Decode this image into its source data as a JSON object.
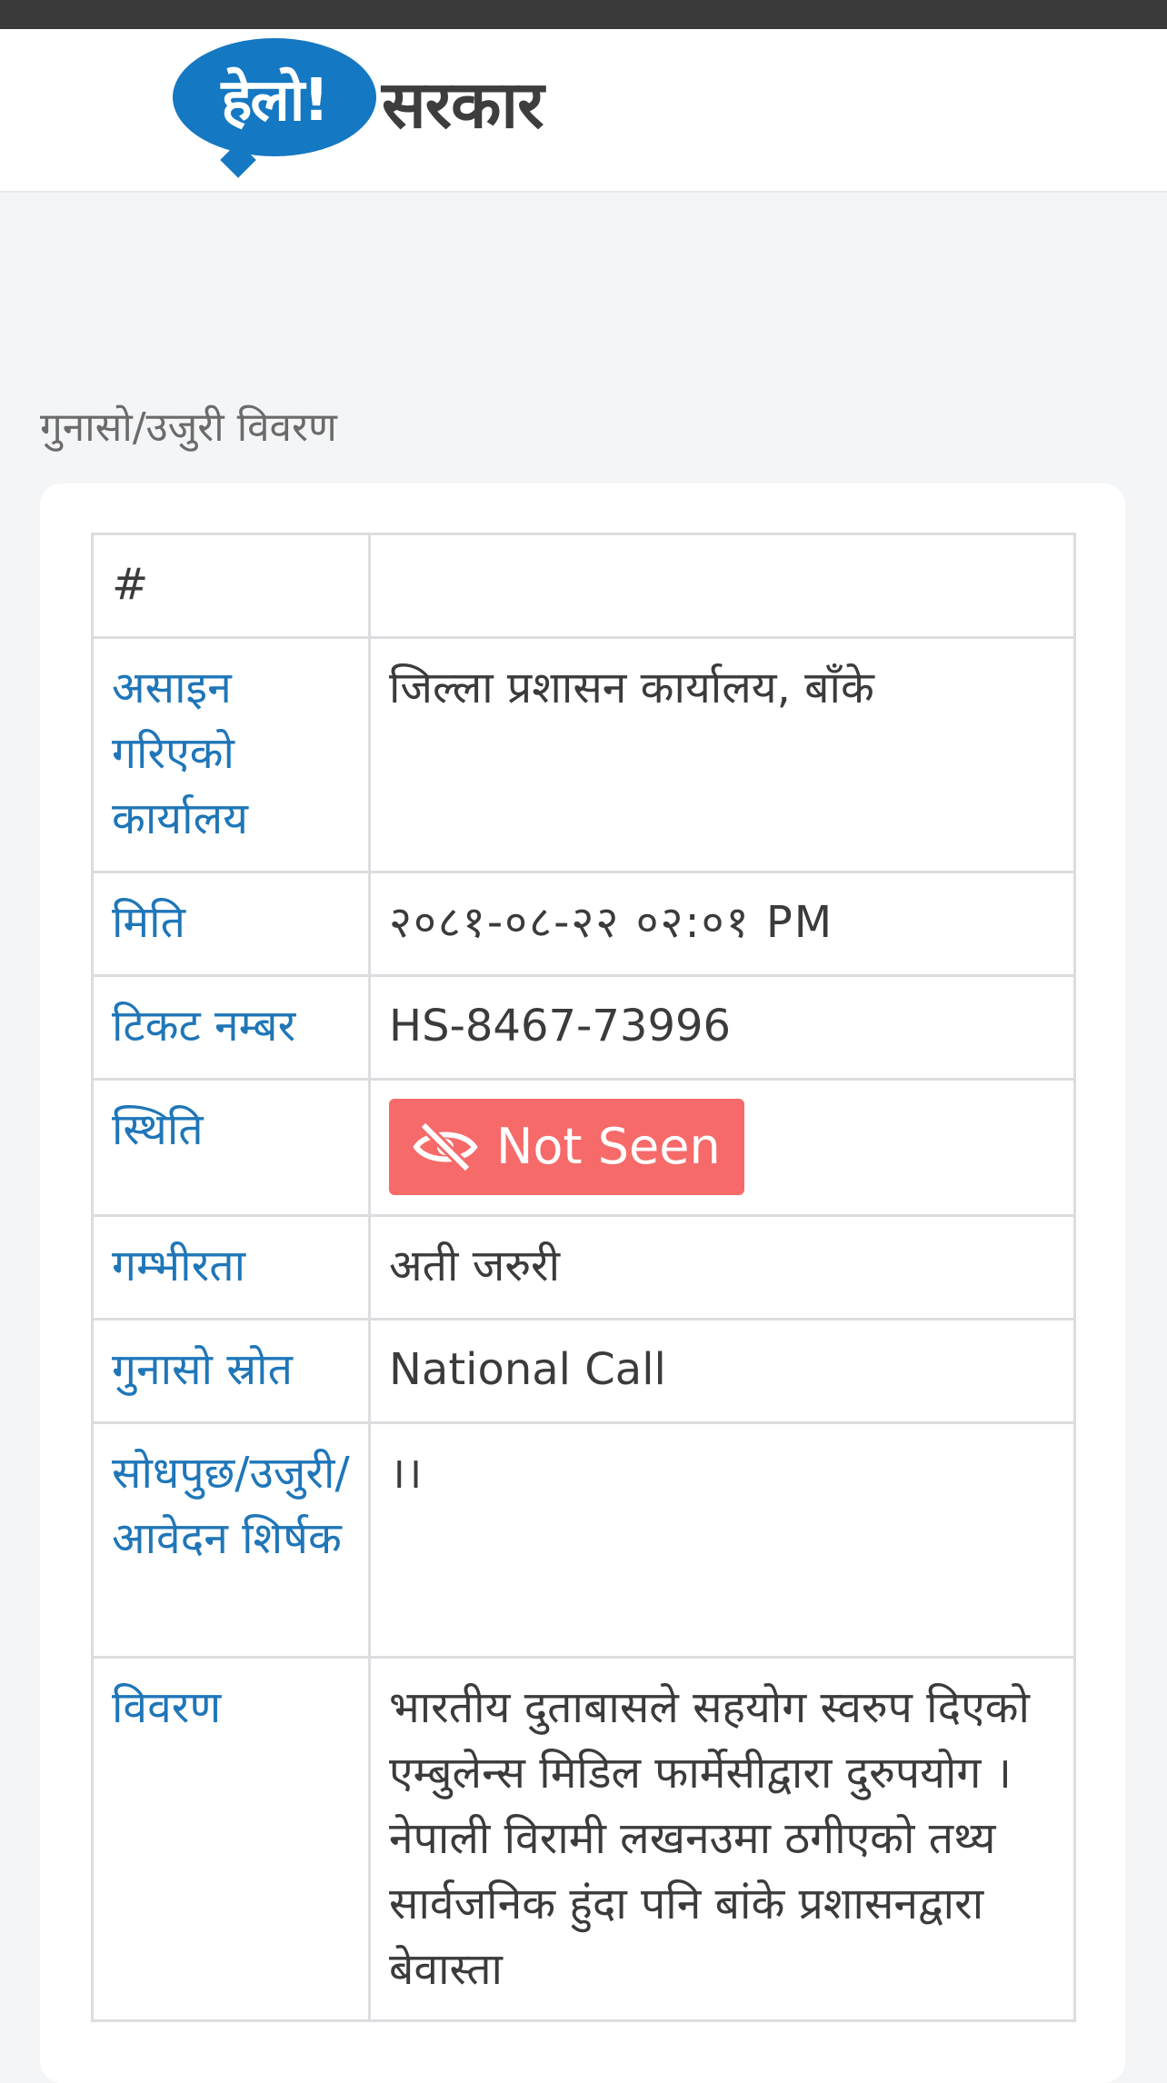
{
  "logo": {
    "bubble_text": "हेलो!",
    "word_text": "सरकार",
    "colors": {
      "bubble": "#1578c2",
      "word": "#3d3d3d"
    }
  },
  "page": {
    "section_title": "गुनासो/उजुरी विवरण"
  },
  "details": {
    "rows": [
      {
        "label": "#",
        "value": ""
      },
      {
        "label": "असाइन गरिएको कार्यालय",
        "value": "जिल्ला प्रशासन कार्यालय, बाँके"
      },
      {
        "label": "मिति",
        "value": "२०८१-०८-२२ ०२:०१ PM"
      },
      {
        "label": "टिकट नम्बर",
        "value": "HS-8467-73996"
      },
      {
        "label": "स्थिति",
        "value": "Not Seen",
        "icon": "eye-slash-icon",
        "badge_color": "#f66a6a"
      },
      {
        "label": "गम्भीरता",
        "value": "अती जरुरी"
      },
      {
        "label": "गुनासो स्रोत",
        "value": "National Call"
      },
      {
        "label": "सोधपुछ/उजुरी/आवेदन शिर्षक",
        "value": "।।"
      },
      {
        "label": "विवरण",
        "value": "भारतीय दुताबासले सहयोग स्वरुप दिएको एम्बुलेन्स मिडिल फार्मेसीद्वारा दुरुपयोग । नेपाली विरामी लखनउमा ठगीएको तथ्य सार्वजनिक हुंदा पनि बांके प्रशासनद्वारा बेवास्ता"
      }
    ]
  },
  "colors": {
    "label_text": "#1f76b8",
    "value_text": "#3b3b3b",
    "header_bg": "#ffffff",
    "page_bg": "#f4f5f7"
  }
}
